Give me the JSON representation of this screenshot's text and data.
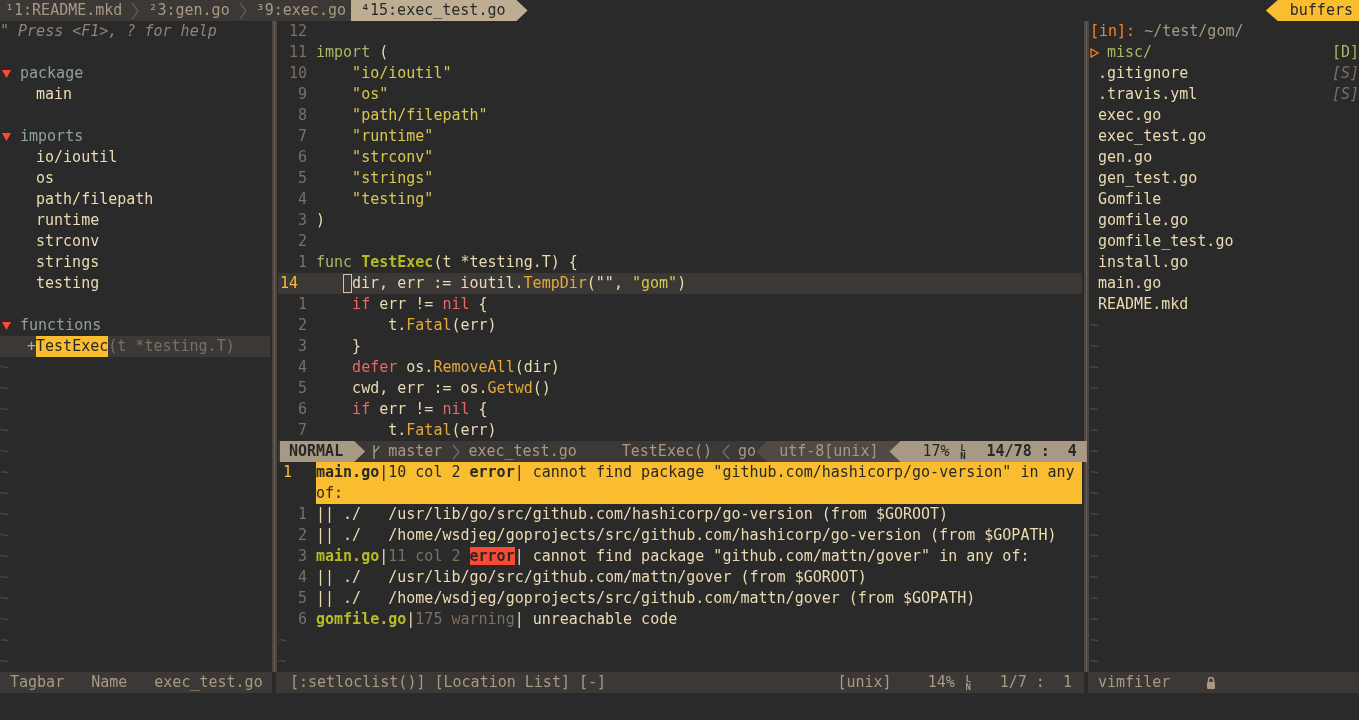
{
  "tabline": {
    "tabs": [
      {
        "label": "¹1:README.mkd",
        "selected": false
      },
      {
        "label": "²3:gen.go",
        "selected": false
      },
      {
        "label": "³9:exec.go",
        "selected": false
      },
      {
        "label": "⁴15:exec_test.go",
        "selected": true
      }
    ],
    "buffers_label": "buffers"
  },
  "tagbar": {
    "help": "\" Press <F1>, ? for help",
    "sections": [
      {
        "label": "package",
        "expanded": true,
        "children": [
          {
            "label": "main",
            "selected": false
          }
        ]
      },
      {
        "label": "imports",
        "expanded": true,
        "children": [
          {
            "label": "io/ioutil",
            "selected": false
          },
          {
            "label": "os",
            "selected": false
          },
          {
            "label": "path/filepath",
            "selected": false
          },
          {
            "label": "runtime",
            "selected": false
          },
          {
            "label": "strconv",
            "selected": false
          },
          {
            "label": "strings",
            "selected": false
          },
          {
            "label": "testing",
            "selected": false
          }
        ]
      },
      {
        "label": "functions",
        "expanded": true,
        "children": [
          {
            "label": "TestExec",
            "signature": "(t *testing.T)",
            "visibility": "+",
            "selected": true
          }
        ]
      }
    ],
    "filler": [
      "~",
      "~",
      "~",
      "~",
      "~",
      "~",
      "~",
      "~",
      "~",
      "~",
      "~",
      "~",
      "~",
      "~",
      "~"
    ]
  },
  "editor": {
    "lines": [
      {
        "number": "12",
        "current": false
      },
      {
        "number": "11",
        "current": false,
        "segments": [
          {
            "text": "import",
            "kind": "keyword"
          },
          {
            "text": " (",
            "kind": "plain"
          }
        ]
      },
      {
        "number": "10",
        "current": false,
        "segments": [
          {
            "text": "    \"io/ioutil\"",
            "kind": "string"
          }
        ]
      },
      {
        "number": "9",
        "current": false,
        "segments": [
          {
            "text": "    \"os\"",
            "kind": "string"
          }
        ]
      },
      {
        "number": "8",
        "current": false,
        "segments": [
          {
            "text": "    \"path/filepath\"",
            "kind": "string"
          }
        ]
      },
      {
        "number": "7",
        "current": false,
        "segments": [
          {
            "text": "    \"runtime\"",
            "kind": "string"
          }
        ]
      },
      {
        "number": "6",
        "current": false,
        "segments": [
          {
            "text": "    \"strconv\"",
            "kind": "string"
          }
        ]
      },
      {
        "number": "5",
        "current": false,
        "segments": [
          {
            "text": "    \"strings\"",
            "kind": "string"
          }
        ]
      },
      {
        "number": "4",
        "current": false,
        "segments": [
          {
            "text": "    \"testing\"",
            "kind": "string"
          }
        ]
      },
      {
        "number": "3",
        "current": false,
        "segments": [
          {
            "text": ")",
            "kind": "plain"
          }
        ]
      },
      {
        "number": "2",
        "current": false
      },
      {
        "number": "1",
        "current": false,
        "segments": [
          {
            "text": "func",
            "kind": "keyword"
          },
          {
            "text": " TestExec",
            "kind": "function"
          },
          {
            "text": "(t *testing.T) {",
            "kind": "plain"
          }
        ]
      },
      {
        "number": "14",
        "current": true,
        "cursor": true,
        "segments": [
          {
            "text": "dir, err := ioutil.",
            "kind": "plain"
          },
          {
            "text": "TempDir",
            "kind": "call"
          },
          {
            "text": "(\"\", ",
            "kind": "plain"
          },
          {
            "text": "\"gom\"",
            "kind": "string"
          },
          {
            "text": ")",
            "kind": "plain"
          }
        ]
      },
      {
        "number": "1",
        "current": false,
        "segments": [
          {
            "text": "    if",
            "kind": "control"
          },
          {
            "text": " err != ",
            "kind": "plain"
          },
          {
            "text": "nil",
            "kind": "control"
          },
          {
            "text": " {",
            "kind": "plain"
          }
        ]
      },
      {
        "number": "2",
        "current": false,
        "segments": [
          {
            "text": "        t.",
            "kind": "plain"
          },
          {
            "text": "Fatal",
            "kind": "call"
          },
          {
            "text": "(err)",
            "kind": "plain"
          }
        ]
      },
      {
        "number": "3",
        "current": false,
        "segments": [
          {
            "text": "    }",
            "kind": "plain"
          }
        ]
      },
      {
        "number": "4",
        "current": false,
        "segments": [
          {
            "text": "    defer",
            "kind": "control"
          },
          {
            "text": " os.",
            "kind": "plain"
          },
          {
            "text": "RemoveAll",
            "kind": "call"
          },
          {
            "text": "(dir)",
            "kind": "plain"
          }
        ]
      },
      {
        "number": "5",
        "current": false,
        "segments": [
          {
            "text": "    cwd, err := os.",
            "kind": "plain"
          },
          {
            "text": "Getwd",
            "kind": "call"
          },
          {
            "text": "()",
            "kind": "plain"
          }
        ]
      },
      {
        "number": "6",
        "current": false,
        "segments": [
          {
            "text": "    if",
            "kind": "control"
          },
          {
            "text": " err != ",
            "kind": "plain"
          },
          {
            "text": "nil",
            "kind": "control"
          },
          {
            "text": " {",
            "kind": "plain"
          }
        ]
      },
      {
        "number": "7",
        "current": false,
        "segments": [
          {
            "text": "        t.",
            "kind": "plain"
          },
          {
            "text": "Fatal",
            "kind": "call"
          },
          {
            "text": "(err)",
            "kind": "plain"
          }
        ]
      }
    ],
    "statusline": {
      "segments": [
        {
          "text": "NORMAL",
          "kind": "mode"
        },
        {
          "text": "master",
          "kind": "branch"
        },
        {
          "text": "exec_test.go",
          "kind": "file"
        },
        {
          "text": "TestExec()",
          "kind": "function"
        },
        {
          "text": "go",
          "kind": "filetype"
        },
        {
          "text": "utf-8[unix]",
          "kind": "encoding"
        },
        {
          "text": "17%",
          "kind": "percent"
        },
        {
          "text": "LN",
          "kind": "line_mark"
        },
        {
          "text": "14/78 :  4",
          "kind": "position"
        }
      ]
    },
    "quickfix": {
      "entries": [
        {
          "number": "1",
          "selected": true,
          "segments": [
            {
              "text": "main.go",
              "kind": "file"
            },
            {
              "text": "|",
              "kind": "bar"
            },
            {
              "text": "10 col 2 ",
              "kind": "location"
            },
            {
              "text": "error",
              "kind": "error"
            },
            {
              "text": "|",
              "kind": "bar"
            },
            {
              "text": " cannot find package \"github.com/hashicorp/go-version\" in any of:",
              "kind": "message"
            }
          ]
        },
        {
          "number": "1",
          "selected": false,
          "segments": [
            {
              "text": "|| ./   /usr/lib/go/src/github.com/hashicorp/go-version (from $GOROOT)",
              "kind": "message"
            }
          ]
        },
        {
          "number": "2",
          "selected": false,
          "segments": [
            {
              "text": "|| ./   /home/wsdjeg/goprojects/src/github.com/hashicorp/go-version (from $GOPATH)",
              "kind": "message"
            }
          ]
        },
        {
          "number": "3",
          "selected": false,
          "segments": [
            {
              "text": "main.go",
              "kind": "file"
            },
            {
              "text": "|",
              "kind": "bar"
            },
            {
              "text": "11 col 2 ",
              "kind": "location"
            },
            {
              "text": "error",
              "kind": "error"
            },
            {
              "text": "|",
              "kind": "bar"
            },
            {
              "text": " cannot find package \"github.com/mattn/gover\" in any of:",
              "kind": "message"
            }
          ]
        },
        {
          "number": "4",
          "selected": false,
          "segments": [
            {
              "text": "|| ./   /usr/lib/go/src/github.com/mattn/gover (from $GOROOT)",
              "kind": "message"
            }
          ]
        },
        {
          "number": "5",
          "selected": false,
          "segments": [
            {
              "text": "|| ./   /home/wsdjeg/goprojects/src/github.com/mattn/gover (from $GOPATH)",
              "kind": "message"
            }
          ]
        },
        {
          "number": "6",
          "selected": false,
          "segments": [
            {
              "text": "gomfile.go",
              "kind": "file"
            },
            {
              "text": "|",
              "kind": "bar"
            },
            {
              "text": "175 warning",
              "kind": "warning"
            },
            {
              "text": "|",
              "kind": "bar"
            },
            {
              "text": " unreachable code",
              "kind": "message"
            }
          ]
        }
      ],
      "filler": [
        "~",
        "~"
      ]
    }
  },
  "filer": {
    "prefix": "[in]:",
    "path": "~/test/gom/",
    "items": [
      {
        "name": "misc/",
        "kind": "directory",
        "tag": "[D]"
      },
      {
        "name": ".gitignore",
        "kind": "file",
        "tag": "[S]"
      },
      {
        "name": ".travis.yml",
        "kind": "file",
        "tag": "[S]"
      },
      {
        "name": "exec.go",
        "kind": "file"
      },
      {
        "name": "exec_test.go",
        "kind": "file"
      },
      {
        "name": "gen.go",
        "kind": "file"
      },
      {
        "name": "gen_test.go",
        "kind": "file"
      },
      {
        "name": "Gomfile",
        "kind": "file"
      },
      {
        "name": "gomfile.go",
        "kind": "file"
      },
      {
        "name": "gomfile_test.go",
        "kind": "file"
      },
      {
        "name": "install.go",
        "kind": "file"
      },
      {
        "name": "main.go",
        "kind": "file"
      },
      {
        "name": "README.mkd",
        "kind": "file"
      }
    ],
    "filler": [
      "~",
      "~",
      "~",
      "~",
      "~",
      "~",
      "~",
      "~",
      "~",
      "~",
      "~",
      "~",
      "~",
      "~",
      "~",
      "~",
      "~"
    ]
  },
  "status_bar": {
    "tagbar": [
      "Tagbar",
      "Name",
      "exec_test.go"
    ],
    "location": {
      "title": "[:setloclist()] [Location List] [-]",
      "format": "[unix]",
      "percent": "14%",
      "line_mark": "LN",
      "position": "1/7 :  1"
    },
    "filer": {
      "name": "vimfiler",
      "locked": true
    }
  }
}
